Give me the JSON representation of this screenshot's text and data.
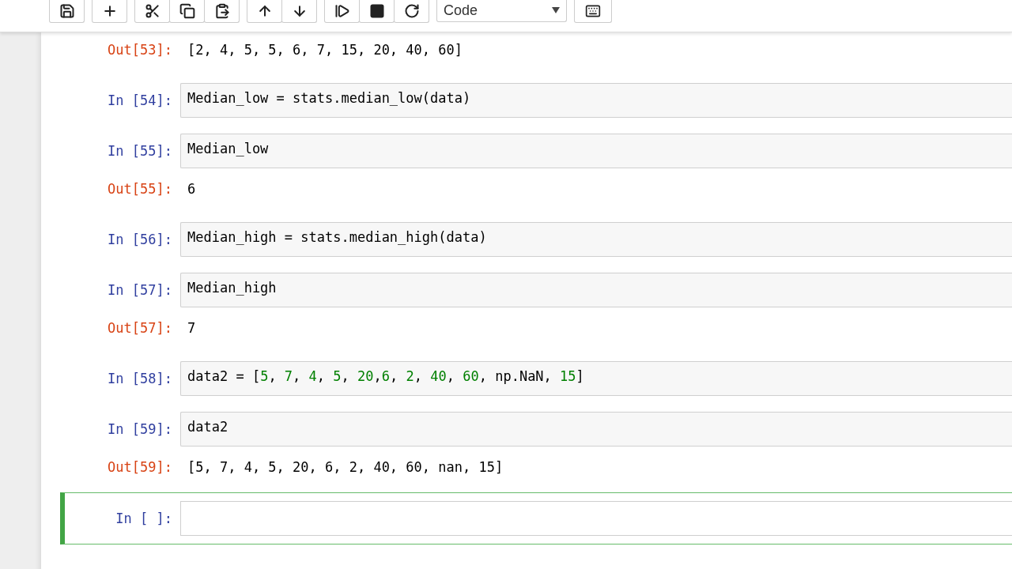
{
  "toolbar": {
    "cell_type": "Code"
  },
  "cells": [
    {
      "kind": "output",
      "prompt": "Out[53]:",
      "text": "[2, 4, 5, 5, 6, 7, 15, 20, 40, 60]"
    },
    {
      "kind": "input",
      "prompt": "In [54]:",
      "selected": false,
      "code": [
        {
          "kind": "plain",
          "text": "Median_low = stats.median_low(data)"
        }
      ]
    },
    {
      "kind": "input",
      "prompt": "In [55]:",
      "selected": false,
      "code": [
        {
          "kind": "plain",
          "text": "Median_low"
        }
      ]
    },
    {
      "kind": "output",
      "prompt": "Out[55]:",
      "text": "6"
    },
    {
      "kind": "input",
      "prompt": "In [56]:",
      "selected": false,
      "code": [
        {
          "kind": "plain",
          "text": "Median_high = stats.median_high(data)"
        }
      ]
    },
    {
      "kind": "input",
      "prompt": "In [57]:",
      "selected": false,
      "code": [
        {
          "kind": "plain",
          "text": "Median_high"
        }
      ]
    },
    {
      "kind": "output",
      "prompt": "Out[57]:",
      "text": "7"
    },
    {
      "kind": "input",
      "prompt": "In [58]:",
      "selected": false,
      "code": [
        {
          "kind": "plain",
          "text": "data2 = ["
        },
        {
          "kind": "number",
          "text": "5"
        },
        {
          "kind": "plain",
          "text": ", "
        },
        {
          "kind": "number",
          "text": "7"
        },
        {
          "kind": "plain",
          "text": ", "
        },
        {
          "kind": "number",
          "text": "4"
        },
        {
          "kind": "plain",
          "text": ", "
        },
        {
          "kind": "number",
          "text": "5"
        },
        {
          "kind": "plain",
          "text": ", "
        },
        {
          "kind": "number",
          "text": "20"
        },
        {
          "kind": "plain",
          "text": ","
        },
        {
          "kind": "number",
          "text": "6"
        },
        {
          "kind": "plain",
          "text": ", "
        },
        {
          "kind": "number",
          "text": "2"
        },
        {
          "kind": "plain",
          "text": ", "
        },
        {
          "kind": "number",
          "text": "40"
        },
        {
          "kind": "plain",
          "text": ", "
        },
        {
          "kind": "number",
          "text": "60"
        },
        {
          "kind": "plain",
          "text": ", np.NaN, "
        },
        {
          "kind": "number",
          "text": "15"
        },
        {
          "kind": "plain",
          "text": "]"
        }
      ]
    },
    {
      "kind": "input",
      "prompt": "In [59]:",
      "selected": false,
      "code": [
        {
          "kind": "plain",
          "text": "data2"
        }
      ]
    },
    {
      "kind": "output",
      "prompt": "Out[59]:",
      "text": "[5, 7, 4, 5, 20, 6, 2, 40, 60, nan, 15]"
    },
    {
      "kind": "input",
      "prompt": "In [ ]:",
      "selected": true
    }
  ]
}
